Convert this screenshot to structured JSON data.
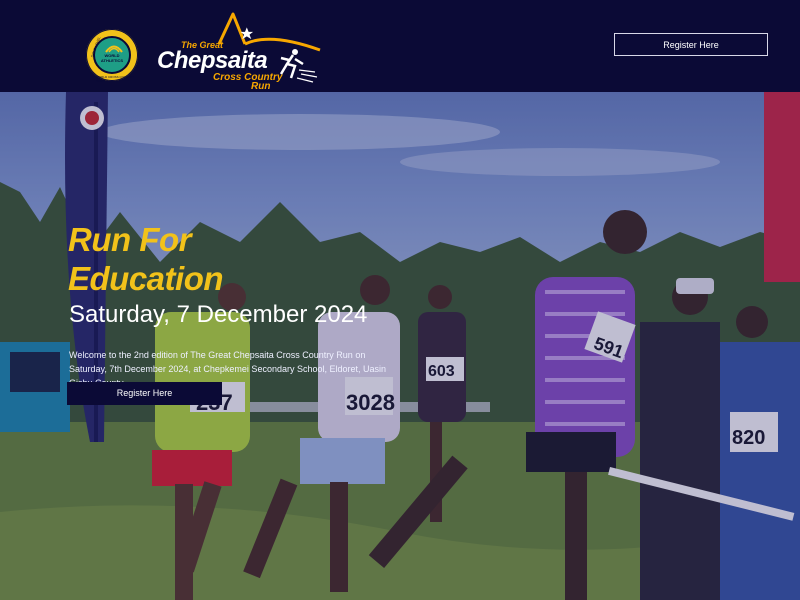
{
  "header": {
    "badge": {
      "text_line1": "GOLD LEVEL",
      "text_line2": "WORLD ATHLETICS",
      "text_line3": "WORLD CROSS COUNTRY TOUR"
    },
    "logo": {
      "small": "The Great",
      "main": "Chepsaita",
      "sub1": "Cross Country",
      "sub2": "Run"
    },
    "register_label": "Register Here"
  },
  "hero": {
    "title_line1": "Run For",
    "title_line2": "Education",
    "date": "Saturday, 7 December 2024",
    "description": "Welcome to the 2nd edition of The Great Chepsaita Cross Country Run on Saturday, 7th December 2024, at Chepkemei Secondary School, Eldoret, Uasin Gishu County.",
    "register_label": "Register Here",
    "bibs": [
      "237",
      "3028",
      "603",
      "591",
      "820"
    ]
  },
  "colors": {
    "header_bg": "#0b0a36",
    "accent_yellow": "#f2c21a",
    "logo_orange": "#f7a700"
  },
  "icons": [
    "world-athletics-badge-icon",
    "runner-logo-icon"
  ]
}
